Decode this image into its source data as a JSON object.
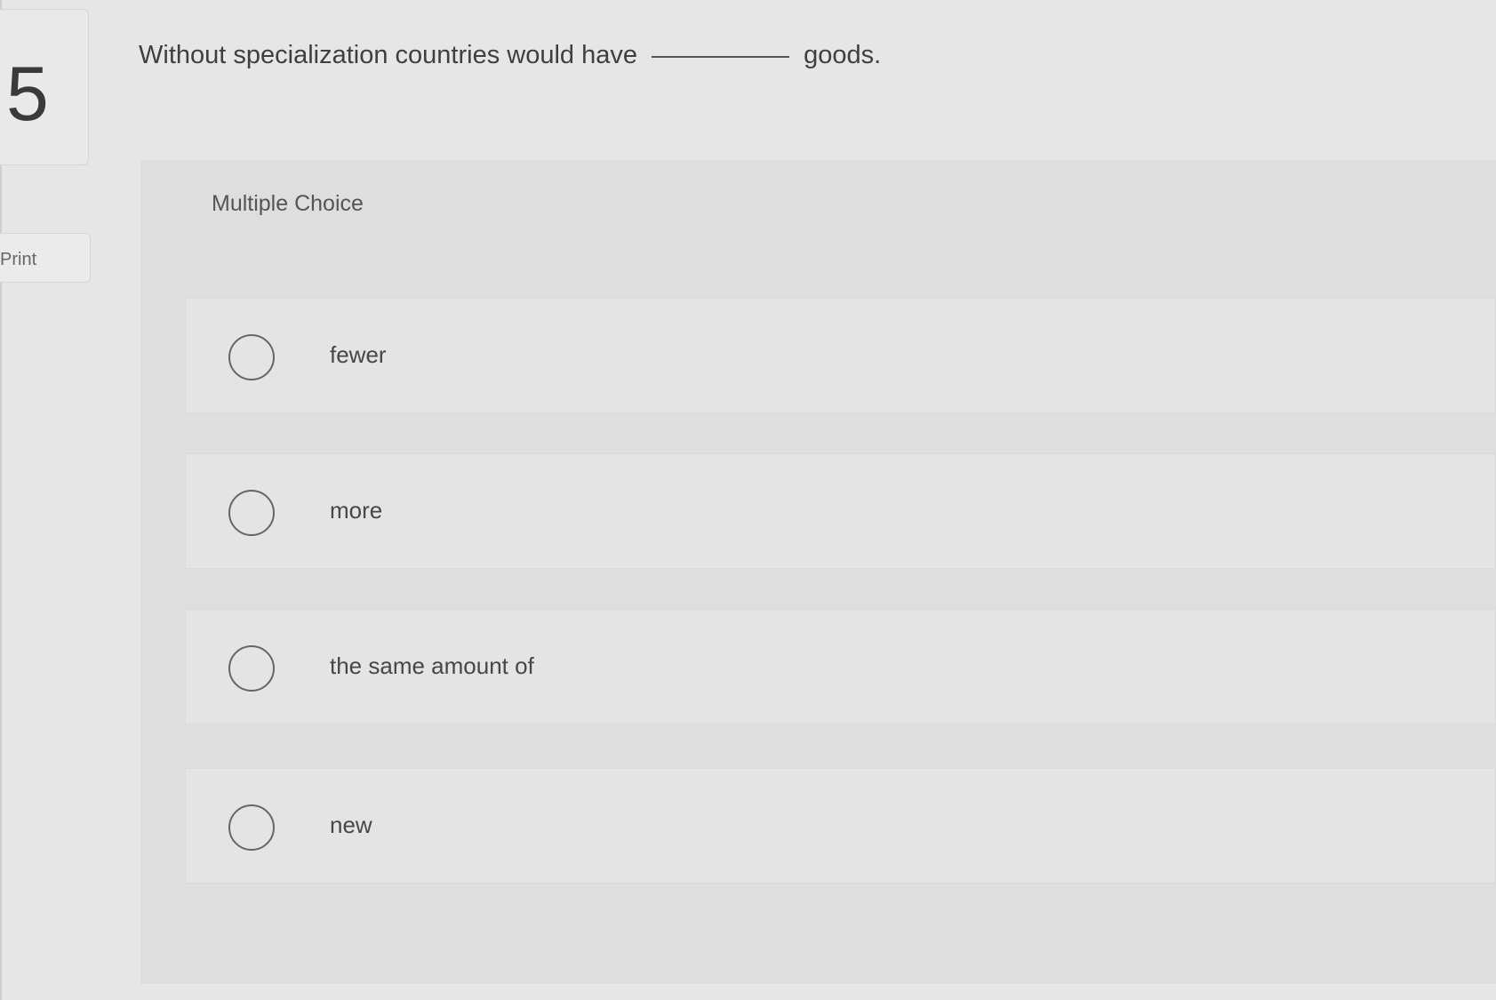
{
  "question": {
    "number": "5",
    "stem_before": "Without specialization countries would have",
    "stem_after": "goods."
  },
  "sidebar": {
    "print_label": "Print"
  },
  "panel": {
    "type_label": "Multiple Choice"
  },
  "options": [
    {
      "label": "fewer"
    },
    {
      "label": "more"
    },
    {
      "label": "the same amount of"
    },
    {
      "label": "new"
    }
  ]
}
